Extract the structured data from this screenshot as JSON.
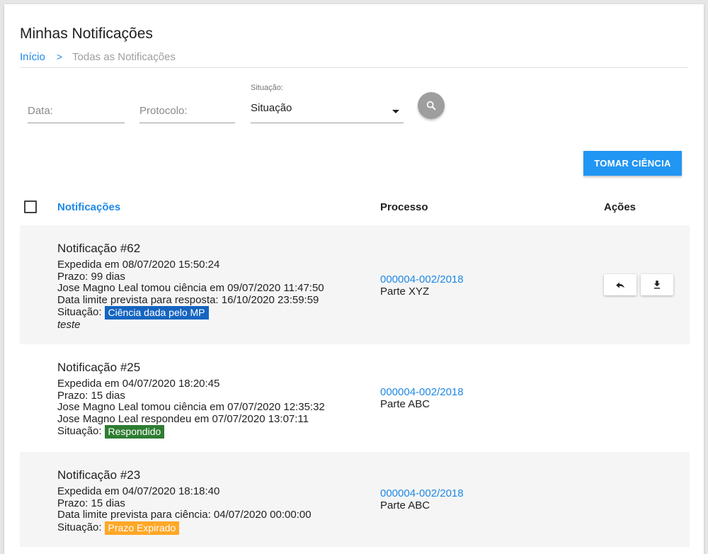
{
  "page": {
    "title": "Minhas Notificações",
    "breadcrumb": {
      "home": "Início",
      "separator": ">",
      "current": "Todas as Notificações"
    }
  },
  "filters": {
    "data_placeholder": "Data:",
    "protocolo_placeholder": "Protocolo:",
    "situacao_label": "Situação:",
    "situacao_value": "Situação",
    "search_icon": "search-icon"
  },
  "actions": {
    "tomar_ciencia": "TOMAR CIÊNCIA"
  },
  "table": {
    "headers": {
      "notificacoes": "Notificações",
      "processo": "Processo",
      "acoes": "Ações"
    },
    "rows": [
      {
        "title": "Notificação #62",
        "lines": [
          "Expedida em 08/07/2020 15:50:24",
          "Prazo: 99 dias",
          "Jose Magno Leal tomou ciência em 09/07/2020 11:47:50",
          "Data limite prevista para resposta: 16/10/2020 23:59:59"
        ],
        "situacao_label": "Situação:",
        "situacao": "Ciência dada pelo MP",
        "situacao_color": "#1565c0",
        "note": "teste",
        "processo": "000004-002/2018",
        "parte": "Parte XYZ",
        "action_icons": [
          "reply-icon",
          "download-icon"
        ]
      },
      {
        "title": "Notificação #25",
        "lines": [
          "Expedida em 04/07/2020 18:20:45",
          "Prazo: 15 dias",
          "Jose Magno Leal tomou ciência em 07/07/2020 12:35:32",
          "Jose Magno Leal respondeu em 07/07/2020 13:07:11"
        ],
        "situacao_label": "Situação:",
        "situacao": "Respondido",
        "situacao_color": "#2e7d32",
        "processo": "000004-002/2018",
        "parte": "Parte ABC"
      },
      {
        "title": "Notificação #23",
        "lines": [
          "Expedida em 04/07/2020 18:18:40",
          "Prazo: 15 dias",
          "Data limite prevista para ciência: 04/07/2020 00:00:00"
        ],
        "situacao_label": "Situação:",
        "situacao": "Prazo Expirado",
        "situacao_color": "#ffa726",
        "processo": "000004-002/2018",
        "parte": "Parte ABC"
      }
    ]
  },
  "colors": {
    "accent": "#1e88e5",
    "button": "#2196f3",
    "row_shade": "#f5f5f5"
  }
}
